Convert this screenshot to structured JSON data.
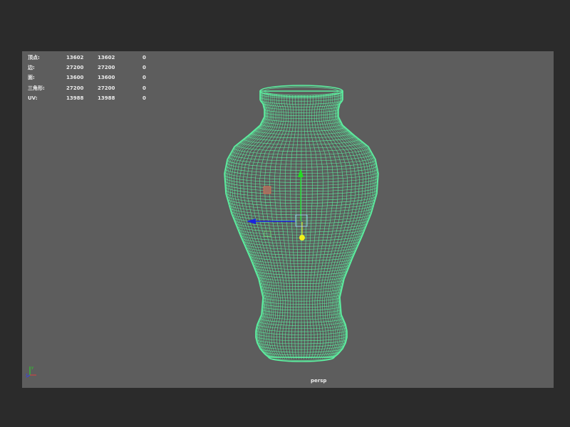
{
  "stats": [
    {
      "label": "顶点:",
      "values": [
        "13602",
        "13602",
        "0"
      ]
    },
    {
      "label": "边:",
      "values": [
        "27200",
        "27200",
        "0"
      ]
    },
    {
      "label": "面:",
      "values": [
        "13600",
        "13600",
        "0"
      ]
    },
    {
      "label": "三角形:",
      "values": [
        "27200",
        "27200",
        "0"
      ]
    },
    {
      "label": "UV:",
      "values": [
        "13988",
        "13988",
        "0"
      ]
    }
  ],
  "viewport": {
    "camera": "persp"
  },
  "colors": {
    "background": "#2b2b2b",
    "viewport": "#5d5d5d",
    "wireframe": "#5cf0a0",
    "manip_y": "#22dd22",
    "manip_x": "#1a24e0",
    "manip_z_handle": "#f2ef1a"
  },
  "icons": [
    "move-manipulator-icon",
    "axis-indicator-icon"
  ]
}
